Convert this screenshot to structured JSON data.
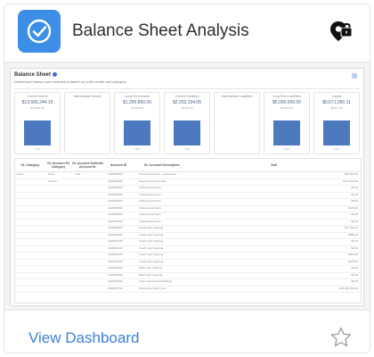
{
  "card": {
    "title": "Balance Sheet Analysis",
    "app_icon": "check-circle-icon",
    "badge_icon": "lock-badge-icon",
    "accent_color": "#3d8ee6"
  },
  "preview": {
    "title": "Balance Sheet",
    "subtitle": "Dashboard leaves user restrictions based on profit center and category",
    "kpis": [
      {
        "label": "Current Assets",
        "value": "$13,666,244.15",
        "sub": "$13,666.24",
        "axis": "Null",
        "level": 0.78
      },
      {
        "label": "Intermediate Assets",
        "value": "",
        "sub": "",
        "axis": "",
        "level": 0
      },
      {
        "label": "Long Term Assets",
        "value": "$1,250,860.00",
        "sub": "$1,250.86",
        "axis": "Null",
        "level": 0.78
      },
      {
        "label": "Current Liabilities",
        "value": "$2,252,194.05",
        "sub": "$2,252.19",
        "axis": "Null",
        "level": 0.78
      },
      {
        "label": "Intermediate Liabilities",
        "value": "",
        "sub": "",
        "axis": "",
        "level": 0
      },
      {
        "label": "Long Term Liabilities",
        "value": "$6,000,000.00",
        "sub": "$6,000.00",
        "axis": "Null",
        "level": 0.78
      },
      {
        "label": "Capital",
        "value": "$5,671,050.11",
        "sub": "$5,671.05",
        "axis": "Null",
        "level": 0.78
      }
    ],
    "table": {
      "headers": [
        "GL Category",
        "GL Account Pri Category",
        "GL Account Subtotal Account Nr",
        "Account ID",
        "GL Account Description",
        "Null"
      ],
      "rows": [
        [
          "Asset",
          "Asset",
          "Null",
          "1100000000",
          "Checking Account - Operational",
          "$38,624.00"
        ],
        [
          "",
          "Current",
          "",
          "1100000100",
          "Checking Account Dept.",
          "$140,560.00"
        ],
        [
          "",
          "",
          "",
          "1100000200",
          "Undeposited Cash",
          "$0.00"
        ],
        [
          "",
          "",
          "",
          "1100000300",
          "Undeposited Cash",
          "$0.00"
        ],
        [
          "",
          "",
          "",
          "1100000400",
          "Undeposited Cash",
          "$0.00"
        ],
        [
          "",
          "",
          "",
          "1100000500",
          "Undeposited Cash",
          "$125.00"
        ],
        [
          "",
          "",
          "",
          "1100000600",
          "Undeposited Cash",
          "$0.00"
        ],
        [
          "",
          "",
          "",
          "1100000700",
          "Undeposited Cash",
          "$0.00"
        ],
        [
          "",
          "",
          "",
          "1100000800",
          "Credit Card Clearing",
          "$17,762.00"
        ],
        [
          "",
          "",
          "",
          "1100000900",
          "Credit Card Clearing",
          "$888.00"
        ],
        [
          "",
          "",
          "",
          "1100001000",
          "Credit Card Clearing",
          "$0.00"
        ],
        [
          "",
          "",
          "",
          "1100001100",
          "Credit Card Clearing",
          "$0.00"
        ],
        [
          "",
          "",
          "",
          "1100001200",
          "Credit Card Clearing",
          "$952.00"
        ],
        [
          "",
          "",
          "",
          "1100001300",
          "Credit Card Clearing",
          "$270.00"
        ],
        [
          "",
          "",
          "",
          "1100001400",
          "Debit Card Clearing",
          "$0.00"
        ],
        [
          "",
          "",
          "",
          "1100001500",
          "Debit Card Clearing",
          "$0.00"
        ],
        [
          "",
          "",
          "",
          "1100001600",
          "Cash Undeposited Holdings",
          "$0.00"
        ],
        [
          "",
          "",
          "",
          "1100001700",
          "Uncollected Cash Loss",
          "$13,493,705.00"
        ]
      ]
    }
  },
  "footer": {
    "view_label": "View Dashboard",
    "favorite_icon": "star-icon"
  }
}
